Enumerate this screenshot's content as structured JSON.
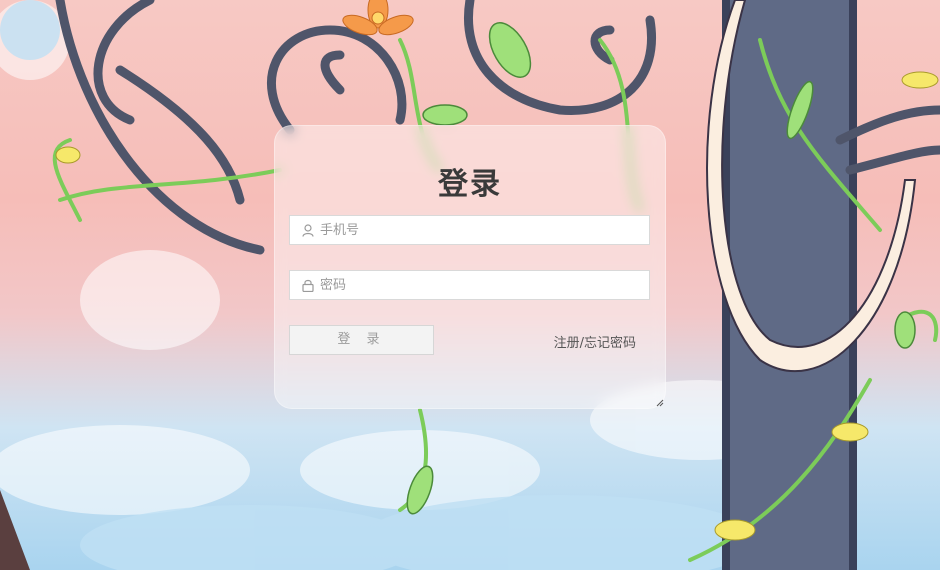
{
  "login": {
    "title": "登录",
    "phone_placeholder": "手机号",
    "password_placeholder": "密码",
    "login_button_label": "登 录",
    "register_link": "注册/忘记密码"
  },
  "icons": {
    "phone_field": "user-icon",
    "password_field": "lock-icon",
    "card_corner": "resize-grip-icon"
  },
  "colors": {
    "title": "#3a3a3a",
    "button_bg": "#f3f3f3",
    "button_text": "#9c9c9c",
    "link_text": "#555555"
  }
}
